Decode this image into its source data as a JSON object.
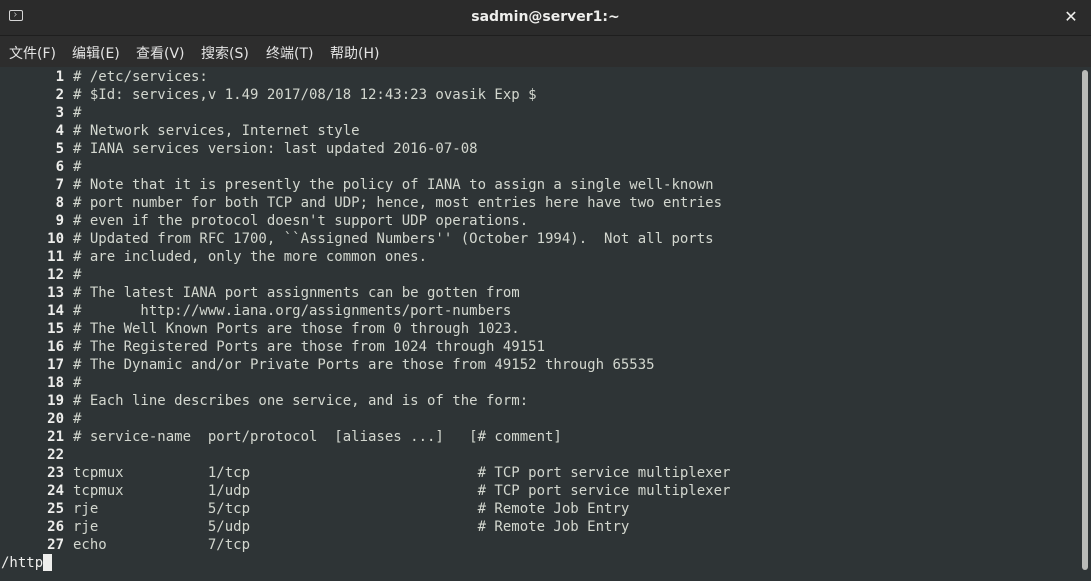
{
  "window": {
    "title": "sadmin@server1:~",
    "close_glyph": "✕"
  },
  "menu": {
    "items": [
      "文件(F)",
      "编辑(E)",
      "查看(V)",
      "搜索(S)",
      "终端(T)",
      "帮助(H)"
    ]
  },
  "lines": [
    {
      "num": "1",
      "text": "# /etc/services:"
    },
    {
      "num": "2",
      "text": "# $Id: services,v 1.49 2017/08/18 12:43:23 ovasik Exp $"
    },
    {
      "num": "3",
      "text": "#"
    },
    {
      "num": "4",
      "text": "# Network services, Internet style"
    },
    {
      "num": "5",
      "text": "# IANA services version: last updated 2016-07-08"
    },
    {
      "num": "6",
      "text": "#"
    },
    {
      "num": "7",
      "text": "# Note that it is presently the policy of IANA to assign a single well-known"
    },
    {
      "num": "8",
      "text": "# port number for both TCP and UDP; hence, most entries here have two entries"
    },
    {
      "num": "9",
      "text": "# even if the protocol doesn't support UDP operations."
    },
    {
      "num": "10",
      "text": "# Updated from RFC 1700, ``Assigned Numbers'' (October 1994).  Not all ports"
    },
    {
      "num": "11",
      "text": "# are included, only the more common ones."
    },
    {
      "num": "12",
      "text": "#"
    },
    {
      "num": "13",
      "text": "# The latest IANA port assignments can be gotten from"
    },
    {
      "num": "14",
      "text": "#       http://www.iana.org/assignments/port-numbers"
    },
    {
      "num": "15",
      "text": "# The Well Known Ports are those from 0 through 1023."
    },
    {
      "num": "16",
      "text": "# The Registered Ports are those from 1024 through 49151"
    },
    {
      "num": "17",
      "text": "# The Dynamic and/or Private Ports are those from 49152 through 65535"
    },
    {
      "num": "18",
      "text": "#"
    },
    {
      "num": "19",
      "text": "# Each line describes one service, and is of the form:"
    },
    {
      "num": "20",
      "text": "#"
    },
    {
      "num": "21",
      "text": "# service-name  port/protocol  [aliases ...]   [# comment]"
    },
    {
      "num": "22",
      "text": ""
    },
    {
      "num": "23",
      "text": "tcpmux          1/tcp                           # TCP port service multiplexer"
    },
    {
      "num": "24",
      "text": "tcpmux          1/udp                           # TCP port service multiplexer"
    },
    {
      "num": "25",
      "text": "rje             5/tcp                           # Remote Job Entry"
    },
    {
      "num": "26",
      "text": "rje             5/udp                           # Remote Job Entry"
    },
    {
      "num": "27",
      "text": "echo            7/tcp"
    }
  ],
  "command_line": "/http"
}
